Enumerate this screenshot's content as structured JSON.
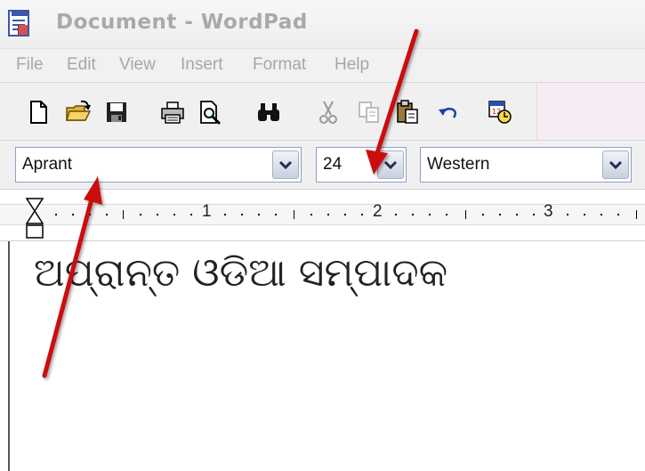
{
  "window": {
    "title": "Document - WordPad"
  },
  "menu": [
    {
      "label": "File"
    },
    {
      "label": "Edit"
    },
    {
      "label": "View"
    },
    {
      "label": "Insert"
    },
    {
      "label": "Format"
    },
    {
      "label": "Help"
    }
  ],
  "toolbar": {
    "buttons": [
      {
        "icon": "new-document-icon"
      },
      {
        "icon": "open-folder-icon"
      },
      {
        "icon": "save-floppy-icon"
      },
      {
        "icon": "print-icon"
      },
      {
        "icon": "print-preview-icon"
      },
      {
        "icon": "find-binoculars-icon"
      },
      {
        "icon": "cut-scissors-icon"
      },
      {
        "icon": "copy-icon"
      },
      {
        "icon": "paste-icon"
      },
      {
        "icon": "undo-icon"
      },
      {
        "icon": "insert-date-time-icon"
      }
    ]
  },
  "format": {
    "font_name": "Aprant",
    "font_size": "24",
    "script": "Western"
  },
  "ruler": {
    "labels": [
      "1",
      "2",
      "3"
    ]
  },
  "document": {
    "text": "ଅପ୍ରାନ୍ତ ଓଡିଆ ସମ୍ପାଦକ"
  },
  "colors": {
    "annotation_arrow": "#cc1111",
    "combo_border": "#8fa0c3",
    "disabled_text": "#a7a7a7"
  }
}
